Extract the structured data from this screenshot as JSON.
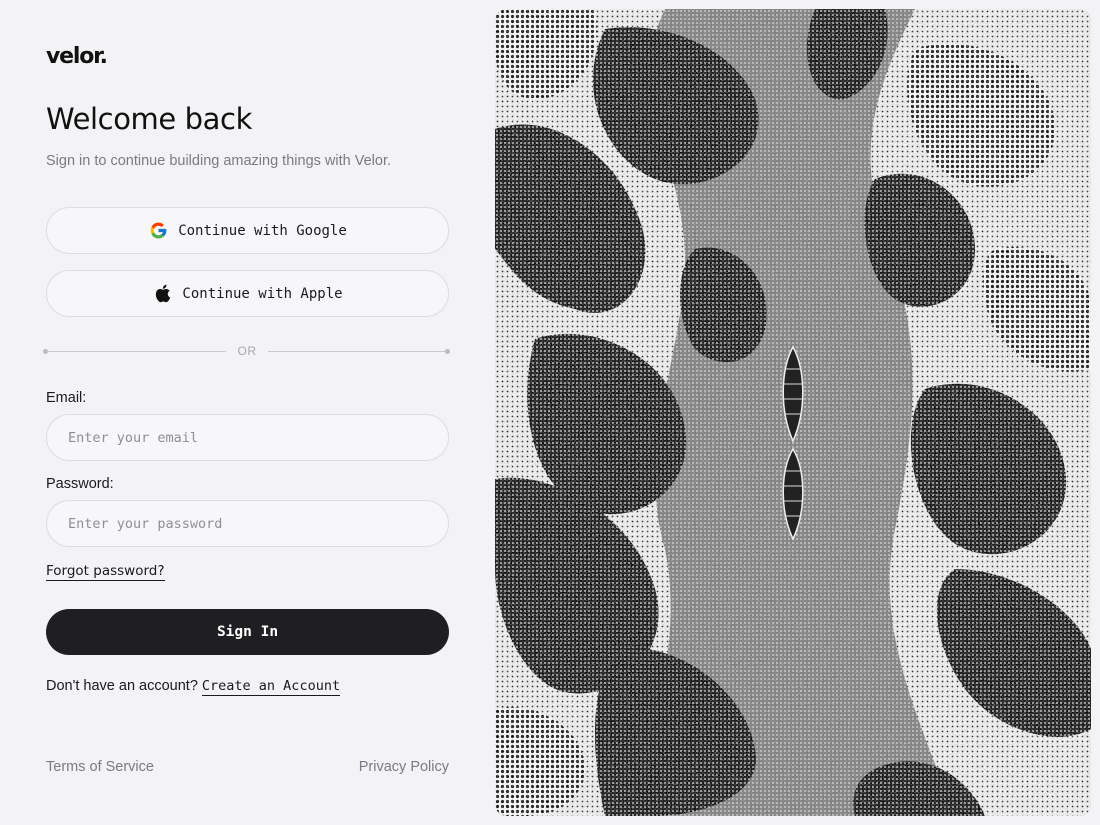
{
  "brand": {
    "logo_text": "velor."
  },
  "header": {
    "title": "Welcome back",
    "subtitle": "Sign in to continue building amazing things with Velor."
  },
  "oauth": {
    "google_label": "Continue with Google",
    "google_icon": "google-icon",
    "apple_label": "Continue with Apple",
    "apple_icon": "apple-icon"
  },
  "divider": {
    "text": "OR"
  },
  "form": {
    "email_label": "Email:",
    "email_placeholder": "Enter your email",
    "email_value": "",
    "password_label": "Password:",
    "password_placeholder": "Enter your password",
    "password_value": "",
    "forgot_label": "Forgot password?",
    "submit_label": "Sign In"
  },
  "signup": {
    "prompt": "Don't have an account?",
    "link_label": "Create an Account"
  },
  "footer": {
    "terms_label": "Terms of Service",
    "privacy_label": "Privacy Policy"
  },
  "colors": {
    "background": "#f3f3f6",
    "primary_button": "#1f1f22",
    "muted_text": "#7a7a82",
    "border": "#dcdce2"
  }
}
